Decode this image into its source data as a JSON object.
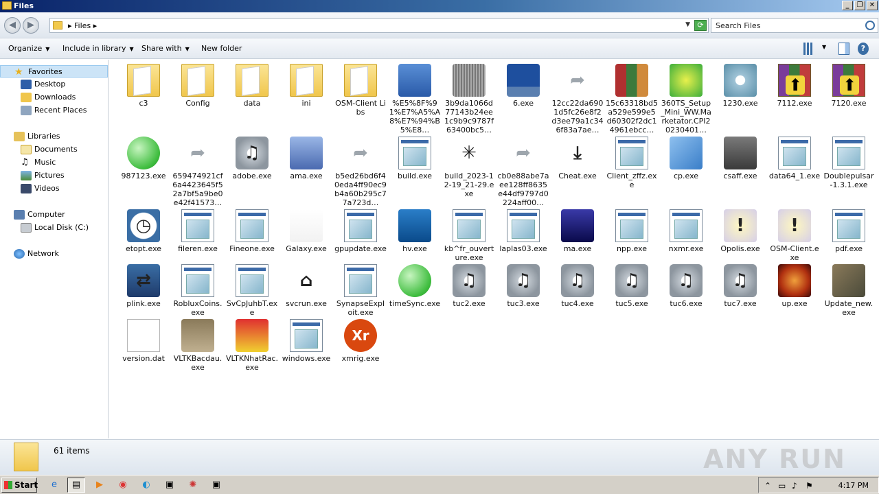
{
  "window": {
    "title": "Files"
  },
  "address": {
    "crumb": "Files",
    "search_placeholder": "Search Files"
  },
  "toolbar": {
    "organize": "Organize",
    "include_in_library": "Include in library",
    "share_with": "Share with",
    "new_folder": "New folder"
  },
  "nav": {
    "favorites": "Favorites",
    "desktop": "Desktop",
    "downloads": "Downloads",
    "recent_places": "Recent Places",
    "libraries": "Libraries",
    "documents": "Documents",
    "music": "Music",
    "pictures": "Pictures",
    "videos": "Videos",
    "computer": "Computer",
    "local_disk": "Local Disk (C:)",
    "network": "Network"
  },
  "files": [
    {
      "name": "c3",
      "icon": "folder-icon"
    },
    {
      "name": "Config",
      "icon": "folder-icon"
    },
    {
      "name": "data",
      "icon": "folder-icon"
    },
    {
      "name": "ini",
      "icon": "folder-icon"
    },
    {
      "name": "OSM-Client Libs",
      "icon": "folder-icon"
    },
    {
      "name": "%E5%8F%91%E7%A5%A8%E7%94%B5%E8…",
      "icon": "folder-shield-icon"
    },
    {
      "name": "3b9da1066d77143b24ee1c9b9c9787f63400bc5…",
      "icon": "blurred-app-icon"
    },
    {
      "name": "6.exe",
      "icon": "terminal-icon"
    },
    {
      "name": "12cc22da6901d5fc26e8f2d3ee79a1c346f83a7ae…",
      "icon": "shortcut-icon"
    },
    {
      "name": "15c63318bd5a529e599e5d60302f2dc14961ebcc…",
      "icon": "winrar-box-icon"
    },
    {
      "name": "360TS_Setup_Mini_WW.Marketator.CPI20230401…",
      "icon": "360-setup-icon"
    },
    {
      "name": "1230.exe",
      "icon": "disc-app-icon"
    },
    {
      "name": "7112.exe",
      "icon": "winrar-icon"
    },
    {
      "name": "7120.exe",
      "icon": "winrar-icon"
    },
    {
      "name": "987123.exe",
      "icon": "green-sphere-icon"
    },
    {
      "name": "659474921cf6a4423645f52a7bf5a9be0e42f41573…",
      "icon": "shortcut-icon"
    },
    {
      "name": "adobe.exe",
      "icon": "music-app-icon"
    },
    {
      "name": "ama.exe",
      "icon": "computer-icon"
    },
    {
      "name": "b5ed26bd6f40eda4ff90ec9b4a60b295c77a723d…",
      "icon": "shortcut-icon"
    },
    {
      "name": "build.exe",
      "icon": "exe-icon"
    },
    {
      "name": "build_2023-12-19_21-29.exe",
      "icon": "spinner-icon"
    },
    {
      "name": "cb0e88abe7aee128ff8635e44df9797d0224aff00…",
      "icon": "shortcut-icon"
    },
    {
      "name": "Cheat.exe",
      "icon": "download-tray-icon"
    },
    {
      "name": "Client_zffz.exe",
      "icon": "exe-icon"
    },
    {
      "name": "cp.exe",
      "icon": "blue-cube-icon"
    },
    {
      "name": "csaff.exe",
      "icon": "gift-icon"
    },
    {
      "name": "data64_1.exe",
      "icon": "exe-icon"
    },
    {
      "name": "Doublepulsar-1.3.1.exe",
      "icon": "exe-icon"
    },
    {
      "name": "etopt.exe",
      "icon": "clock-icon"
    },
    {
      "name": "fileren.exe",
      "icon": "exe-icon"
    },
    {
      "name": "Fineone.exe",
      "icon": "exe-icon"
    },
    {
      "name": "Galaxy.exe",
      "icon": "visual-studio-icon"
    },
    {
      "name": "gpupdate.exe",
      "icon": "exe-icon"
    },
    {
      "name": "hv.exe",
      "icon": "intel-box-icon"
    },
    {
      "name": "kb^fr_ouverture.exe",
      "icon": "exe-icon"
    },
    {
      "name": "laplas03.exe",
      "icon": "exe-icon"
    },
    {
      "name": "ma.exe",
      "icon": "dark-box-icon"
    },
    {
      "name": "npp.exe",
      "icon": "exe-icon"
    },
    {
      "name": "nxmr.exe",
      "icon": "exe-icon"
    },
    {
      "name": "Opolis.exe",
      "icon": "warning-bubble-icon"
    },
    {
      "name": "OSM-Client.exe",
      "icon": "warning-bubble-icon"
    },
    {
      "name": "pdf.exe",
      "icon": "exe-icon"
    },
    {
      "name": "plink.exe",
      "icon": "putty-icon"
    },
    {
      "name": "RobluxCoins.exe",
      "icon": "exe-icon"
    },
    {
      "name": "SvCpJuhbT.exe",
      "icon": "exe-icon"
    },
    {
      "name": "svcrun.exe",
      "icon": "house-doc-icon"
    },
    {
      "name": "SynapseExploit.exe",
      "icon": "exe-icon"
    },
    {
      "name": "timeSync.exe",
      "icon": "green-sphere-icon"
    },
    {
      "name": "tuc2.exe",
      "icon": "music-app-icon"
    },
    {
      "name": "tuc3.exe",
      "icon": "music-app-icon"
    },
    {
      "name": "tuc4.exe",
      "icon": "music-app-icon"
    },
    {
      "name": "tuc5.exe",
      "icon": "music-app-icon"
    },
    {
      "name": "tuc6.exe",
      "icon": "music-app-icon"
    },
    {
      "name": "tuc7.exe",
      "icon": "music-app-icon"
    },
    {
      "name": "up.exe",
      "icon": "orange-emblem-icon"
    },
    {
      "name": "Update_new.exe",
      "icon": "camo-box-icon"
    },
    {
      "name": "version.dat",
      "icon": "blank-doc-icon"
    },
    {
      "name": "VLTKBacdau.exe",
      "icon": "game-character-icon"
    },
    {
      "name": "VLTKNhatRac.exe",
      "icon": "game-tile-icon"
    },
    {
      "name": "windows.exe",
      "icon": "exe-icon"
    },
    {
      "name": "xmrig.exe",
      "icon": "xmrig-icon"
    }
  ],
  "status": {
    "count": "61 items"
  },
  "watermark": "ANY RUN",
  "taskbar": {
    "start": "Start",
    "time": "4:17 PM"
  }
}
